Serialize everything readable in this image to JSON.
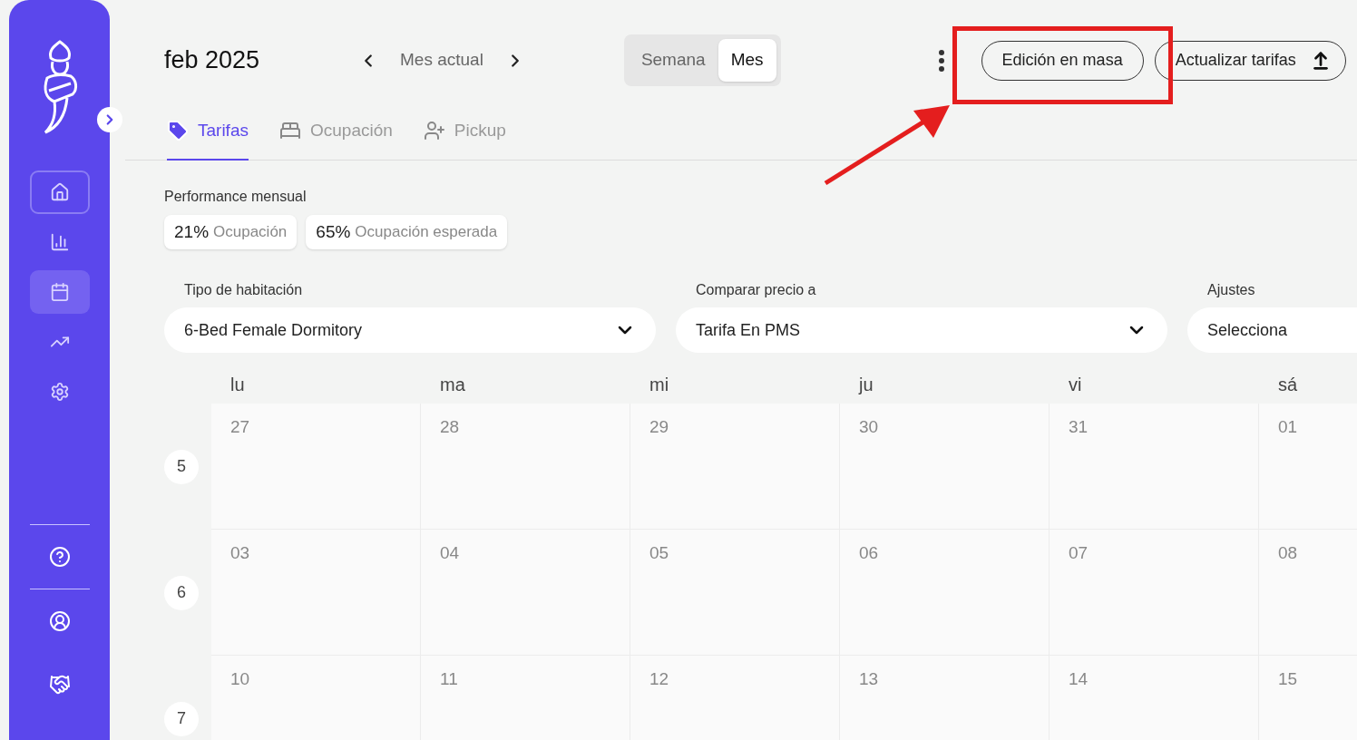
{
  "sidebar": {
    "nav_items": [
      {
        "selected": false,
        "focused": true
      },
      {
        "selected": false,
        "focused": false
      },
      {
        "selected": true,
        "focused": false
      },
      {
        "selected": false,
        "focused": false
      },
      {
        "selected": false,
        "focused": false
      }
    ],
    "bottom_items": [
      {
        "kind": "help"
      },
      {
        "kind": "user"
      },
      {
        "kind": "handshake"
      }
    ]
  },
  "header": {
    "title": "feb 2025",
    "period": "Mes actual",
    "view_toggle": [
      {
        "label": "Semana",
        "selected": false
      },
      {
        "label": "Mes",
        "selected": true
      }
    ],
    "buttons": [
      {
        "label": "Edición en masa",
        "kind": "plain"
      },
      {
        "label": "Actualizar tarifas",
        "kind": "upload"
      }
    ]
  },
  "tabs": [
    {
      "label": "Tarifas",
      "kind": "tag",
      "selected": true
    },
    {
      "label": "Ocupación",
      "kind": "bed",
      "selected": false
    },
    {
      "label": "Pickup",
      "kind": "user-plus",
      "selected": false
    }
  ],
  "performance": {
    "title": "Performance mensual",
    "chips": [
      {
        "value": "21%",
        "label": "Ocupación"
      },
      {
        "value": "65%",
        "label": "Ocupación esperada"
      }
    ]
  },
  "filters": [
    {
      "label": "Tipo de habitación",
      "value": "6-Bed Female Dormitory",
      "kind": "select"
    },
    {
      "label": "Comparar precio a",
      "value": "Tarifa En PMS",
      "kind": "select"
    },
    {
      "label": "Ajustes",
      "value": "Selecciona",
      "kind": "select"
    }
  ],
  "calendar": {
    "weekdays": [
      "lu",
      "ma",
      "mi",
      "ju",
      "vi",
      "sá"
    ],
    "weeks": [
      {
        "number": "5",
        "days": [
          "27",
          "28",
          "29",
          "30",
          "31",
          "01"
        ]
      },
      {
        "number": "6",
        "days": [
          "03",
          "04",
          "05",
          "06",
          "07",
          "08"
        ]
      },
      {
        "number": "7",
        "days": [
          "10",
          "11",
          "12",
          "13",
          "14",
          "15"
        ]
      }
    ]
  }
}
